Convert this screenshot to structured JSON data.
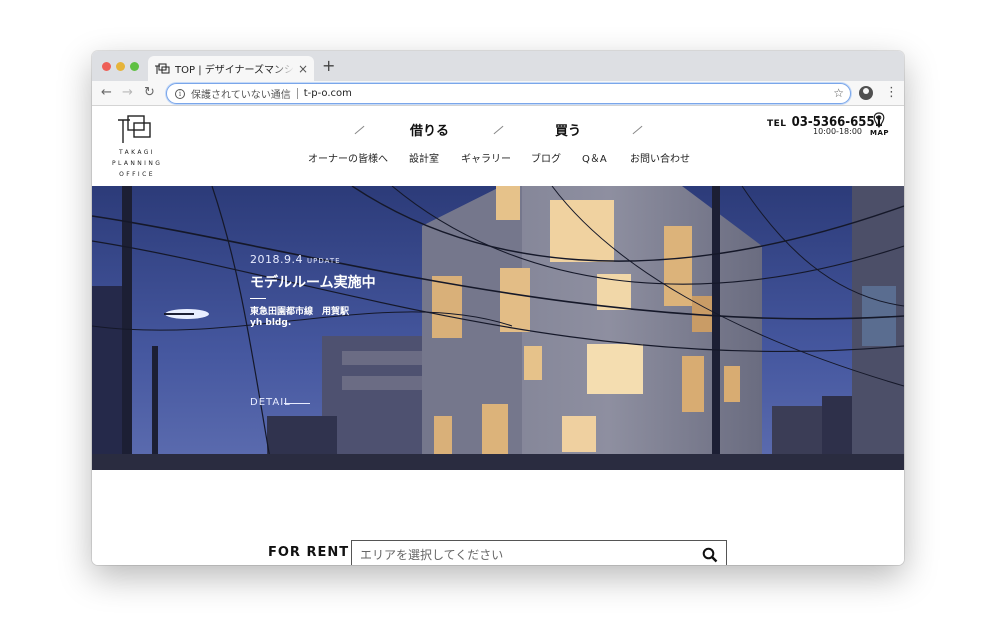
{
  "browser": {
    "tab_title": "TOP | デザイナーズマンション・デザイナーズ賃貸",
    "tab_close": "×",
    "new_tab": "+",
    "security_text": "保護されていない通信",
    "url": "t-p-o.com",
    "icons": [
      "back-icon",
      "forward-icon",
      "reload-icon",
      "info-icon",
      "star-icon",
      "profile-icon",
      "menu-icon"
    ]
  },
  "header": {
    "logo_text": "TAKAGI PLANNING OFFICE",
    "nav_main": [
      "借りる",
      "買う"
    ],
    "nav_sub": [
      "オーナーの皆様へ",
      "設計室",
      "ギャラリー",
      "ブログ",
      "Q＆A",
      "お問い合わせ"
    ],
    "tel_label": "TEL",
    "tel_number": "03-5366-6551",
    "hours": "10:00-18:00",
    "map_label": "MAP"
  },
  "hero": {
    "date": "2018.9.4",
    "update_label": "UPDATE",
    "title": "モデルルーム実施中",
    "station": "東急田園都市線　用賀駅",
    "building": "yh bldg.",
    "detail": "DETAIL"
  },
  "search": {
    "label": "FOR RENT",
    "placeholder": "エリアを選択してください"
  },
  "colors": {
    "hero_sky": "#3b4a86",
    "window_light": "#f2d7a5",
    "omnibox_focus": "#7aa6ea"
  }
}
